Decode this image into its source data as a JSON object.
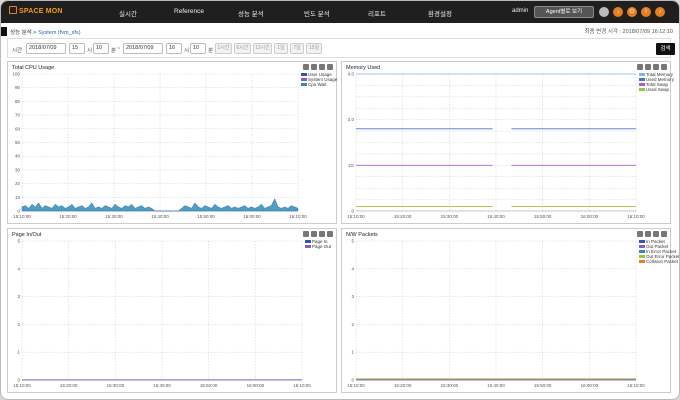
{
  "app": {
    "logo": "SPACE MON"
  },
  "nav": {
    "items": [
      "실시간",
      "Reference",
      "성능 분석",
      "빈도 분석",
      "리포트",
      "환경설정"
    ]
  },
  "user": {
    "name": "admin",
    "agent_button": "Agent별로 보기"
  },
  "header_icons": [
    "user-circle-icon",
    "download-icon",
    "power-icon",
    "info-icon",
    "bell-icon"
  ],
  "breadcrumb": {
    "parent": "성능 분석",
    "sep": ">",
    "current": "System (fvm_sfs)"
  },
  "last_query": "최종 변경 시각 : 2018/07/09 16:12:10",
  "filter": {
    "time_label": "시간",
    "start_date": "2018/07/09",
    "start_hour": "15",
    "start_min": "10",
    "sep": "~",
    "end_date": "2018/07/09",
    "end_hour": "16",
    "end_min": "10",
    "hour_unit": "시",
    "min_unit": "분",
    "presets": [
      "1시간",
      "6시간",
      "12시간",
      "1일",
      "7일",
      "15일"
    ],
    "search": "검색"
  },
  "colors": {
    "user": "#2f56b5",
    "system": "#8a5bc0",
    "cpu_wait": "#2a8fb5",
    "total_memory": "#7fb6e6",
    "used_memory": "#4a76c4",
    "total_swap": "#b05dc7",
    "used_swap": "#9dc43a"
  },
  "chart_data": [
    {
      "type": "area",
      "title": "Total CPU Usage",
      "x_ticks": [
        "15:10:00",
        "15:20:00",
        "15:30:00",
        "15:40:00",
        "15:50:00",
        "16:00:00",
        "16:10:00"
      ],
      "ylim": [
        0,
        100
      ],
      "y_ticks": [
        "0",
        "10",
        "20",
        "30",
        "40",
        "50",
        "60",
        "70",
        "80",
        "90",
        "100"
      ],
      "legend": [
        "User Usage",
        "System Usage",
        "Cpu Wait"
      ],
      "series": [
        {
          "name": "User Usage",
          "values": [
            3,
            4,
            2,
            5,
            3,
            6,
            2,
            4,
            3,
            2,
            5,
            3,
            4,
            2,
            3,
            5,
            2,
            3,
            4,
            2,
            3,
            6,
            2,
            3,
            2,
            4,
            3,
            2,
            5,
            3,
            2,
            4,
            3,
            5,
            2,
            3,
            4,
            2,
            3,
            2,
            0,
            0,
            0,
            0,
            0,
            0,
            0,
            0,
            2,
            4,
            3,
            2,
            6,
            3,
            2,
            4,
            3,
            2,
            5,
            3,
            2,
            3,
            4,
            2,
            3,
            2,
            3,
            4,
            2,
            3,
            2,
            3,
            5,
            2,
            3,
            4,
            9,
            3,
            2,
            3,
            2,
            4,
            3,
            2
          ]
        }
      ]
    },
    {
      "type": "line",
      "title": "Memory Used",
      "x_ticks": [
        "15:10:00",
        "15:20:00",
        "15:30:00",
        "15:40:00",
        "15:50:00",
        "16:00:00",
        "16:10:00"
      ],
      "y_ticks": [
        "0",
        "",
        "",
        "",
        "1G",
        "",
        "",
        "",
        "2.0",
        "",
        "",
        "",
        "4.0"
      ],
      "legend": [
        "Total Memory",
        "Used Memory",
        "Total Swap",
        "Used Swap"
      ],
      "series": [
        {
          "name": "Total Memory",
          "value": 4.0
        },
        {
          "name": "Used Memory",
          "value": 1.8
        },
        {
          "name": "Total Swap",
          "value": 1.0
        },
        {
          "name": "Used Swap",
          "value": 0.1
        }
      ]
    },
    {
      "type": "line",
      "title": "Page In/Out",
      "x_ticks": [
        "15:10:00",
        "15:20:00",
        "15:30:00",
        "15:40:00",
        "15:50:00",
        "16:00:00",
        "16:10:00"
      ],
      "ylim": [
        0,
        5
      ],
      "y_ticks": [
        "0",
        "1",
        "2",
        "3",
        "4",
        "5"
      ],
      "legend": [
        "Page In",
        "Page Out"
      ],
      "series": [
        {
          "name": "Page In",
          "value": 0
        },
        {
          "name": "Page Out",
          "value": 0
        }
      ]
    },
    {
      "type": "line",
      "title": "N/W Packets",
      "x_ticks": [
        "15:10:00",
        "15:20:00",
        "15:30:00",
        "15:40:00",
        "15:50:00",
        "16:00:00",
        "16:10:00"
      ],
      "ylim": [
        0,
        5
      ],
      "y_ticks": [
        "0",
        "1",
        "2",
        "3",
        "4",
        "5"
      ],
      "legend": [
        "In Packet",
        "Out Packet",
        "In Error Packet",
        "Out Error Packet",
        "Collision Packet"
      ],
      "series": [
        {
          "name": "In Packet",
          "value": 0
        },
        {
          "name": "Out Packet",
          "value": 0
        },
        {
          "name": "In Error Packet",
          "value": 0
        },
        {
          "name": "Out Error Packet",
          "value": 0
        },
        {
          "name": "Collision Packet",
          "value": 0
        }
      ]
    }
  ]
}
